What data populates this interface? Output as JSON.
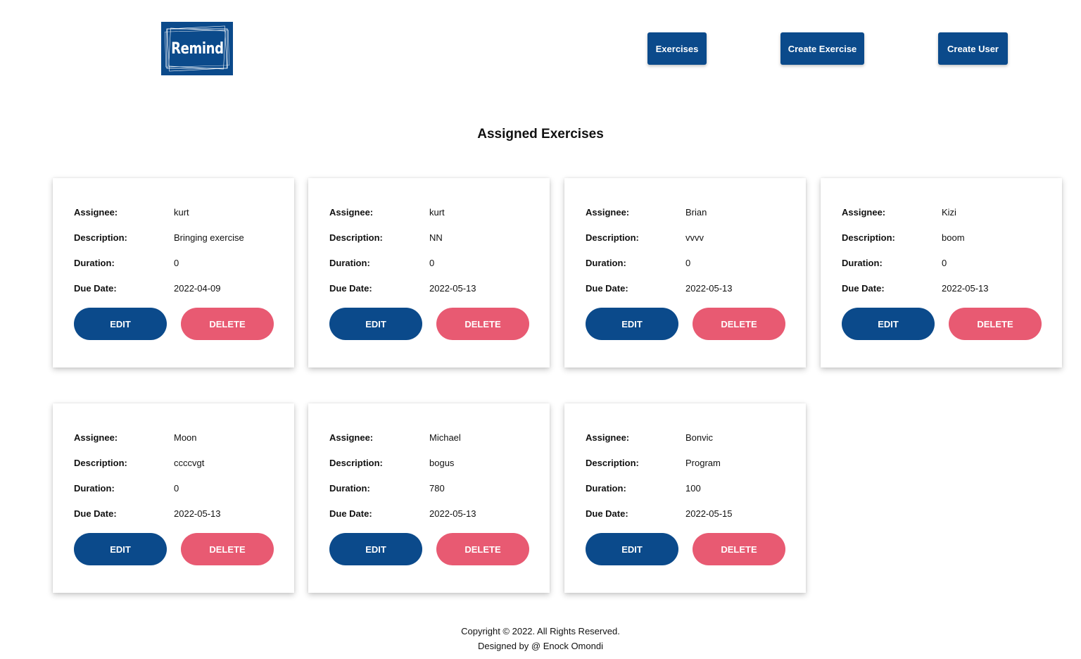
{
  "header": {
    "logo_text": "Remind",
    "nav": {
      "exercises": "Exercises",
      "create_exercise": "Create Exercise",
      "create_user": "Create User"
    }
  },
  "main": {
    "title": "Assigned Exercises",
    "labels": {
      "assignee": "Assignee:",
      "description": "Description:",
      "duration": "Duration:",
      "due_date": "Due Date:",
      "edit": "EDIT",
      "delete": "DELETE"
    },
    "cards": [
      {
        "assignee": "kurt",
        "description": "Bringing exercise",
        "duration": "0",
        "due_date": "2022-04-09"
      },
      {
        "assignee": "kurt",
        "description": "NN",
        "duration": "0",
        "due_date": "2022-05-13"
      },
      {
        "assignee": "Brian",
        "description": "vvvv",
        "duration": "0",
        "due_date": "2022-05-13"
      },
      {
        "assignee": "Kizi",
        "description": "boom",
        "duration": "0",
        "due_date": "2022-05-13"
      },
      {
        "assignee": "Moon",
        "description": "ccccvgt",
        "duration": "0",
        "due_date": "2022-05-13"
      },
      {
        "assignee": "Michael",
        "description": "bogus",
        "duration": "780",
        "due_date": "2022-05-13"
      },
      {
        "assignee": "Bonvic",
        "description": "Program",
        "duration": "100",
        "due_date": "2022-05-15"
      }
    ]
  },
  "footer": {
    "copyright": "Copyright © 2022. All Rights Reserved.",
    "designer": "Designed by @ Enock Omondi"
  },
  "colors": {
    "primary": "#0b4a8b",
    "danger": "#e85a72"
  }
}
